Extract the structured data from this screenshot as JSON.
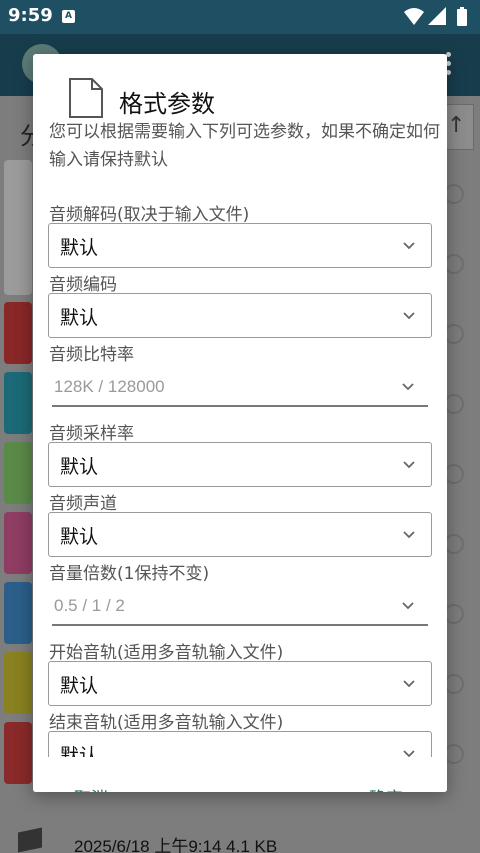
{
  "status_bar": {
    "time": "9:59",
    "notification_letter": "A",
    "icons": [
      "wifi-icon",
      "signal-icon",
      "battery-icon"
    ]
  },
  "background_app": {
    "partial_label": "分",
    "footer_text": "2025/6/18 上午9:14   4.1 KB"
  },
  "dialog": {
    "title": "格式参数",
    "description": "您可以根据需要输入下列可选参数，如果不确定如何输入请保持默认",
    "fields": [
      {
        "label": "音频解码(取决于输入文件)",
        "value": "默认",
        "kind": "dropdown"
      },
      {
        "label": "音频编码",
        "value": "默认",
        "kind": "dropdown"
      },
      {
        "label": "音频比特率",
        "placeholder": "128K / 128000",
        "kind": "input"
      },
      {
        "label": "音频采样率",
        "value": "默认",
        "kind": "dropdown"
      },
      {
        "label": "音频声道",
        "value": "默认",
        "kind": "dropdown"
      },
      {
        "label": "音量倍数(1保持不变)",
        "placeholder": "0.5 / 1 / 2",
        "kind": "input"
      },
      {
        "label": "开始音轨(适用多音轨输入文件)",
        "value": "默认",
        "kind": "dropdown"
      },
      {
        "label": "结束音轨(适用多音轨输入文件)",
        "value": "默认",
        "kind": "dropdown"
      }
    ],
    "cancel_label": "取消",
    "ok_label": "确定"
  },
  "colors": {
    "accent": "#1b7a6a",
    "status_bar": "#1f4f63",
    "scrim": "#7d7d7d"
  }
}
